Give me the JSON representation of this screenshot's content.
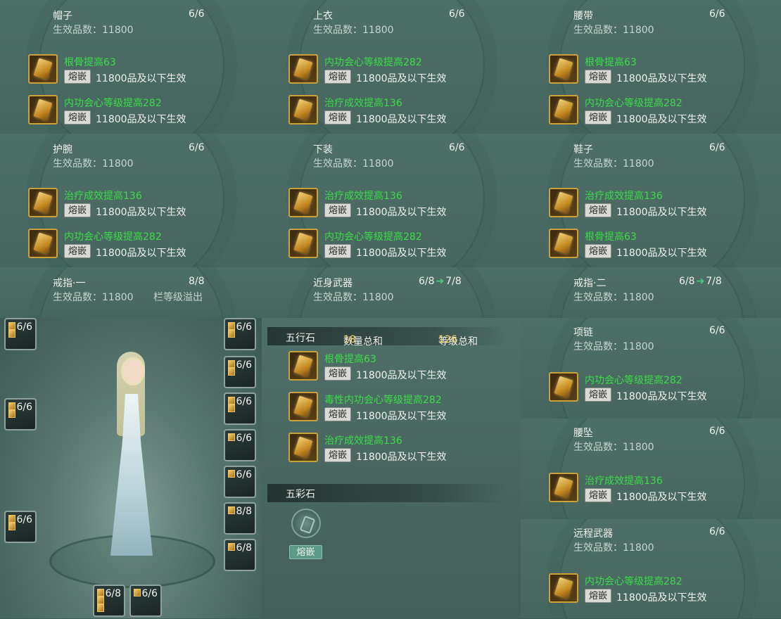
{
  "panels": [
    {
      "name": "帽子",
      "count": "6/6",
      "qual": "生效品数：11800",
      "gems": [
        {
          "stat": "根骨提高63",
          "btn": "熔嵌",
          "eff": "11800品及以下生效"
        },
        {
          "stat": "内功会心等级提高282",
          "btn": "熔嵌",
          "eff": "11800品及以下生效"
        }
      ]
    },
    {
      "name": "上衣",
      "count": "6/6",
      "qual": "生效品数：11800",
      "gems": [
        {
          "stat": "内功会心等级提高282",
          "btn": "熔嵌",
          "eff": "11800品及以下生效"
        },
        {
          "stat": "治疗成效提高136",
          "btn": "熔嵌",
          "eff": "11800品及以下生效"
        }
      ]
    },
    {
      "name": "腰带",
      "count": "6/6",
      "qual": "生效品数：11800",
      "gems": [
        {
          "stat": "根骨提高63",
          "btn": "熔嵌",
          "eff": "11800品及以下生效"
        },
        {
          "stat": "内功会心等级提高282",
          "btn": "熔嵌",
          "eff": "11800品及以下生效"
        }
      ]
    },
    {
      "name": "护腕",
      "count": "6/6",
      "qual": "生效品数：11800",
      "gems": [
        {
          "stat": "治疗成效提高136",
          "btn": "熔嵌",
          "eff": "11800品及以下生效"
        },
        {
          "stat": "内功会心等级提高282",
          "btn": "熔嵌",
          "eff": "11800品及以下生效"
        }
      ]
    },
    {
      "name": "下装",
      "count": "6/6",
      "qual": "生效品数：11800",
      "gems": [
        {
          "stat": "治疗成效提高136",
          "btn": "熔嵌",
          "eff": "11800品及以下生效"
        },
        {
          "stat": "内功会心等级提高282",
          "btn": "熔嵌",
          "eff": "11800品及以下生效"
        }
      ]
    },
    {
      "name": "鞋子",
      "count": "6/6",
      "qual": "生效品数：11800",
      "gems": [
        {
          "stat": "治疗成效提高136",
          "btn": "熔嵌",
          "eff": "11800品及以下生效"
        },
        {
          "stat": "根骨提高63",
          "btn": "熔嵌",
          "eff": "11800品及以下生效"
        }
      ]
    }
  ],
  "row3": {
    "ring1": {
      "name": "戒指·一",
      "count": "8/8",
      "qual": "生效品数：11800",
      "extra": "栏等级溢出"
    },
    "melee": {
      "name": "近身武器",
      "count_from": "6/8",
      "arrow": "➔",
      "count_to": "7/8",
      "qual": "生效品数：11800"
    },
    "ring2": {
      "name": "戒指·二",
      "count_from": "6/8",
      "arrow": "➔",
      "count_to": "7/8",
      "qual": "生效品数：11800"
    }
  },
  "right_stack": [
    {
      "name": "项链",
      "count": "6/6",
      "qual": "生效品数：11800",
      "gem": {
        "stat": "内功会心等级提高282",
        "btn": "熔嵌",
        "eff": "11800品及以下生效"
      }
    },
    {
      "name": "腰坠",
      "count": "6/6",
      "qual": "生效品数：11800",
      "gem": {
        "stat": "治疗成效提高136",
        "btn": "熔嵌",
        "eff": "11800品及以下生效"
      }
    },
    {
      "name": "远程武器",
      "count": "6/6",
      "qual": "生效品数：11800",
      "gem": {
        "stat": "内功会心等级提高282",
        "btn": "熔嵌",
        "eff": "11800品及以下生效"
      }
    }
  ],
  "wuxing": {
    "title": "五行石",
    "qty_label": "数量总和",
    "qty": "18",
    "lvl_label": "等级总和",
    "lvl": "126",
    "gems": [
      {
        "stat": "根骨提高63",
        "btn": "熔嵌",
        "eff": "11800品及以下生效"
      },
      {
        "stat": "毒性内功会心等级提高282",
        "btn": "熔嵌",
        "eff": "11800品及以下生效"
      },
      {
        "stat": "治疗成效提高136",
        "btn": "熔嵌",
        "eff": "11800品及以下生效"
      }
    ]
  },
  "wucai": {
    "title": "五彩石",
    "btn": "熔嵌"
  },
  "mini_slots": {
    "left": [
      "6/6",
      "6/6",
      "6/6"
    ],
    "right": [
      "6/6",
      "6/6",
      "6/6",
      "6/6",
      "6/6",
      "8/8",
      "6/8"
    ],
    "bottom": [
      "6/8",
      "6/6"
    ]
  },
  "colors": {
    "gem_stat": "#3bdc48",
    "accent_num": "#f3d36a",
    "arrow": "#4ccf7a"
  }
}
